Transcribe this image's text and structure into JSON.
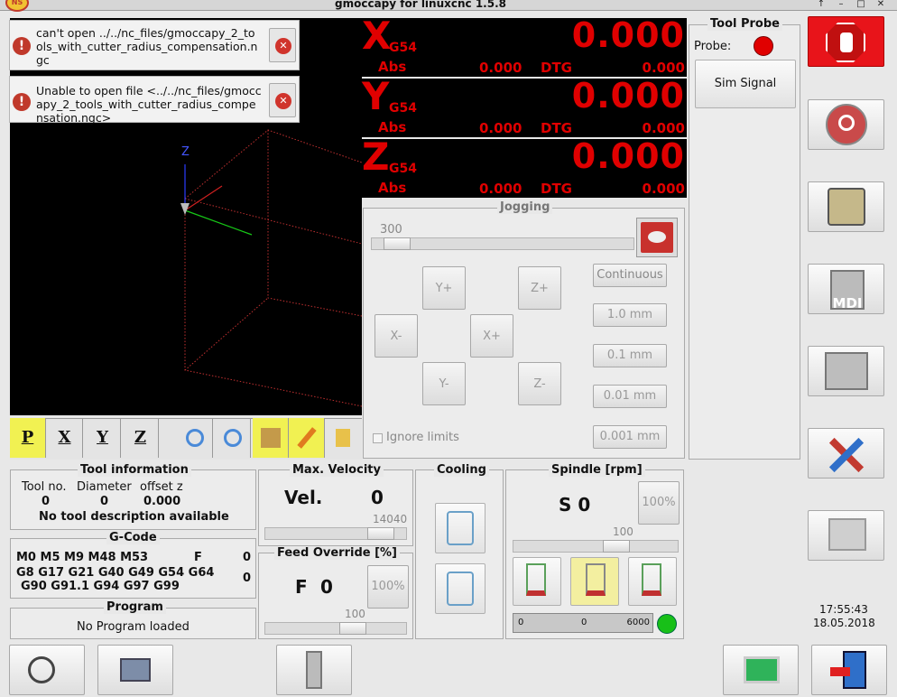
{
  "window": {
    "title": "gmoccapy for linuxcnc  1.5.8",
    "buttons": [
      "↑",
      "–",
      "□",
      "✕"
    ]
  },
  "messages": [
    {
      "text": "can't open ../../nc_files/gmoccapy_2_tools_with_cutter_radius_compensation.ngc"
    },
    {
      "text": "Unable to open file <../../nc_files/gmoccapy_2_tools_with_cutter_radius_compensation.ngc>"
    }
  ],
  "preview": {
    "z_label": "Z"
  },
  "dro": [
    {
      "axis": "X",
      "sys": "G54",
      "value": "0.000",
      "abs_label": "Abs",
      "abs": "0.000",
      "dtg_label": "DTG",
      "dtg": "0.000"
    },
    {
      "axis": "Y",
      "sys": "G54",
      "value": "0.000",
      "abs_label": "Abs",
      "abs": "0.000",
      "dtg_label": "DTG",
      "dtg": "0.000"
    },
    {
      "axis": "Z",
      "sys": "G54",
      "value": "0.000",
      "abs_label": "Abs",
      "abs": "0.000",
      "dtg_label": "DTG",
      "dtg": "0.000"
    }
  ],
  "tool_probe": {
    "title": "Tool Probe",
    "probe_label": "Probe:",
    "sim_signal": "Sim Signal"
  },
  "jogging": {
    "title": "Jogging",
    "speed": "300",
    "speed_fraction": 0.05,
    "buttons": {
      "yplus": "Y+",
      "zplus": "Z+",
      "xminus": "X-",
      "xplus": "X+",
      "yminus": "Y-",
      "zminus": "Z-"
    },
    "increments": [
      "Continuous",
      "1.0 mm",
      "0.1 mm",
      "0.01 mm",
      "0.001 mm"
    ],
    "ignore_limits": "Ignore limits"
  },
  "view_toolbar": {
    "p": "P",
    "x": "X",
    "y": "Y",
    "z": "Z"
  },
  "tool_info": {
    "title": "Tool information",
    "h_tool": "Tool no.",
    "h_diam": "Diameter",
    "h_offset": "offset z",
    "tool": "0",
    "diam": "0",
    "offset": "0.000",
    "desc": "No tool description available"
  },
  "gcode": {
    "title": "G-Code",
    "line1": "M0 M5 M9 M48 M53",
    "f_label": "F",
    "f_val": "0",
    "line2": "G8 G17 G21 G40 G49 G54 G64",
    "line3": "G90 G91.1 G94 G97 G99",
    "s_val": "0"
  },
  "program": {
    "title": "Program",
    "text": "No Program loaded"
  },
  "velocity": {
    "title": "Max. Velocity",
    "label": "Vel.",
    "value": "0",
    "max": "14040",
    "fraction": 0.9
  },
  "feed": {
    "title": "Feed Override [%]",
    "label": "F",
    "value": "0",
    "reset": "100%",
    "slider_label": "100",
    "fraction": 0.65
  },
  "cooling": {
    "title": "Cooling"
  },
  "spindle": {
    "title": "Spindle [rpm]",
    "s_display": "S 0",
    "reset": "100%",
    "slider_label": "100",
    "fraction": 0.65,
    "bar_min": "0",
    "bar_val": "0",
    "bar_max": "6000"
  },
  "clock": {
    "time": "17:55:43",
    "date": "18.05.2018"
  },
  "colors": {
    "dro_text": "#e00000",
    "probe": "#e00000",
    "estop": "#e8141a",
    "spindle_ok": "#18c018"
  }
}
